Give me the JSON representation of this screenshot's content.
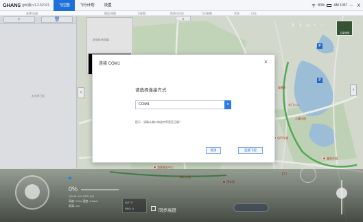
{
  "app": {
    "logo": "GHANS",
    "version": "(ph)版 v1.2.52101",
    "tabs": [
      {
        "label": "飞控图",
        "active": true
      },
      {
        "label": "飞行计划",
        "active": false
      },
      {
        "label": "设置",
        "active": false
      }
    ],
    "status": {
      "battery": "80%",
      "time": "AM 1057",
      "minimize": "—",
      "close": "X"
    }
  },
  "subbar": {
    "items": [
      "选择/连接",
      "图层/地图",
      "卫星图",
      "航线与任务",
      "飞行参数",
      "状态",
      "日志"
    ]
  },
  "left_panel": {
    "add_label": "+",
    "delete_label": "🗑",
    "empty_text": "未选择飞机"
  },
  "float_panel": {
    "label": "[未选择/未连接]"
  },
  "map": {
    "dropdown": "▾",
    "tools": [
      "⬇",
      "⬆",
      "⊗",
      "+",
      "—"
    ],
    "satellite_label": "卫星地图",
    "places": [
      "自行车道",
      "健身步道",
      "游客服务中心",
      "湖心公园",
      "停车场",
      "东门入口",
      "儿童乐园",
      "观景台",
      "北门"
    ],
    "markers": [
      "P",
      "P"
    ]
  },
  "hud": {
    "percent": "0%",
    "line1": "HDOP: 0.0   GPS: 0/0",
    "line2": "高度: 0.0m  速度: 0.0m/s",
    "line3": "距离: 0m",
    "box_line1": "ALT: 0",
    "box_line2": "SPD: 0",
    "sync_label": "同步高度"
  },
  "modal": {
    "title": "连接 COM1",
    "close": "×",
    "prompt": "请选择连接方式",
    "port_value": "COM1",
    "hint": "提示：请确认端口和波特率是否正确？",
    "cancel_label": "取消",
    "connect_label": "连接飞控"
  },
  "colors": {
    "accent": "#1e6fd9",
    "water": "#a8cde8",
    "road": "#ffffff",
    "park": "#cfe6c2"
  }
}
